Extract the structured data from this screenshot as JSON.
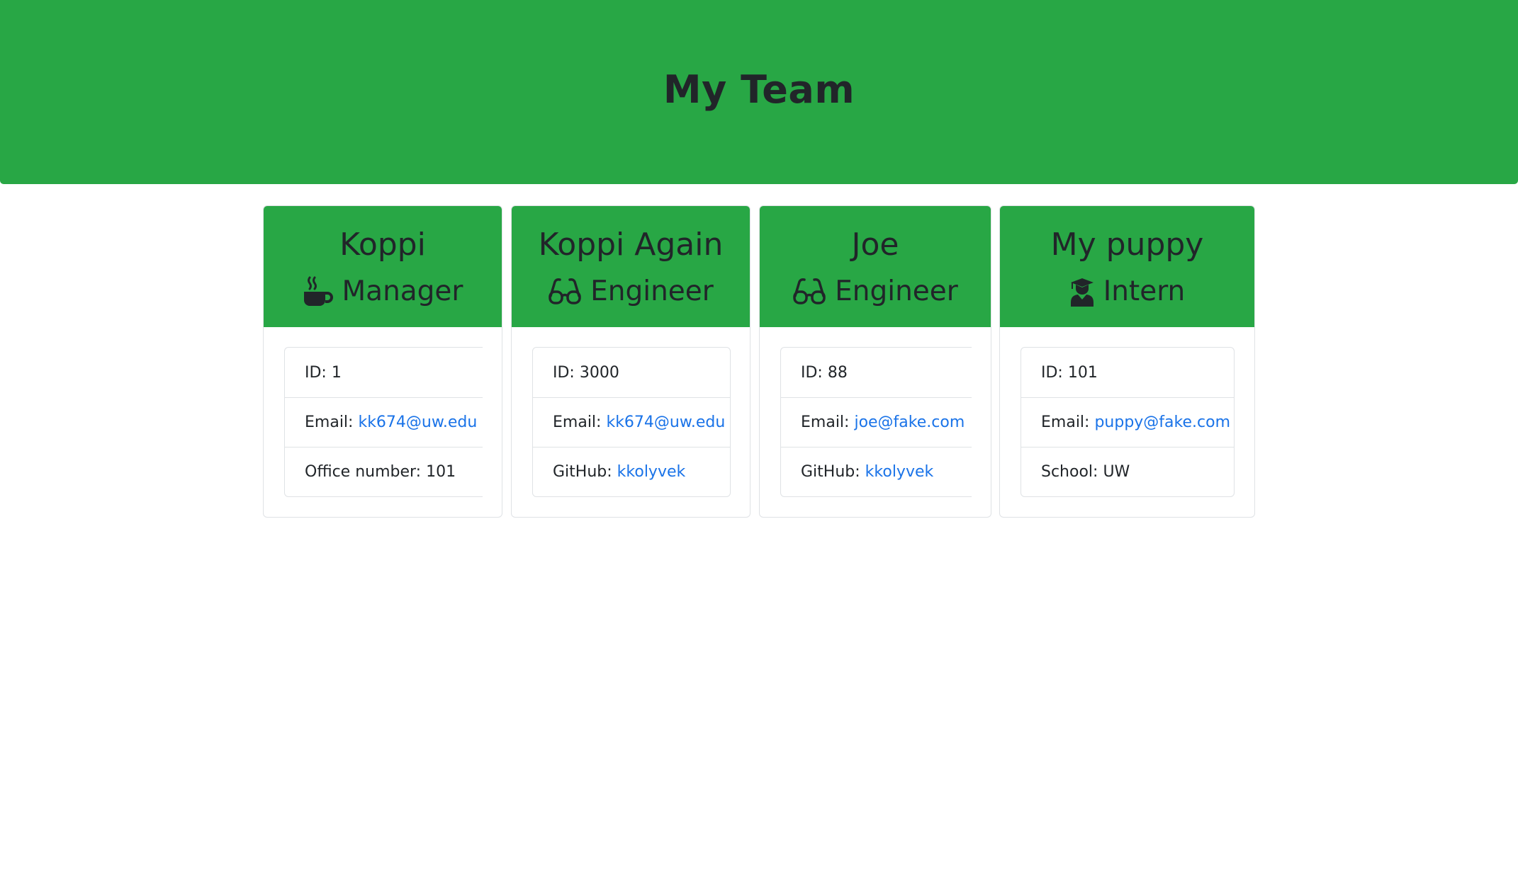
{
  "header": {
    "title": "My Team"
  },
  "employees": [
    {
      "name": "Koppi",
      "role": "Manager",
      "icon": "coffee-mug-icon",
      "id_label": "ID:",
      "id": "1",
      "email_label": "Email:",
      "email": "kk674@uw.edu",
      "extra_label": "Office number:",
      "extra": "101"
    },
    {
      "name": "Koppi Again",
      "role": "Engineer",
      "icon": "glasses-icon",
      "id_label": "ID:",
      "id": "3000",
      "email_label": "Email:",
      "email": "kk674@uw.edu",
      "extra_label": "GitHub:",
      "extra": "kkolyvek"
    },
    {
      "name": "Joe",
      "role": "Engineer",
      "icon": "glasses-icon",
      "id_label": "ID:",
      "id": "88",
      "email_label": "Email:",
      "email": "joe@fake.com",
      "extra_label": "GitHub:",
      "extra": "kkolyvek"
    },
    {
      "name": "My puppy",
      "role": "Intern",
      "icon": "graduate-icon",
      "id_label": "ID:",
      "id": "101",
      "email_label": "Email:",
      "email": "puppy@fake.com",
      "extra_label": "School:",
      "extra": "UW"
    }
  ],
  "colors": {
    "header_bg": "#28a745",
    "text": "#212529",
    "link": "#1a73e8",
    "border": "#dfe2e5"
  }
}
